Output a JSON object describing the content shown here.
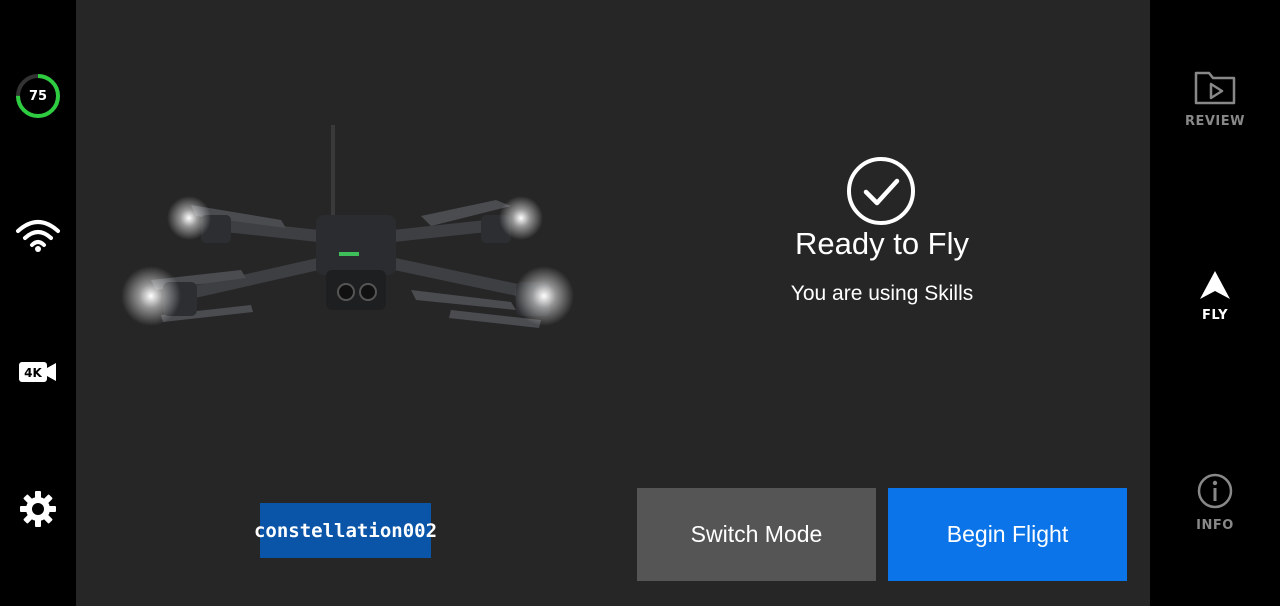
{
  "status": {
    "battery_percent": "75",
    "battery_level": 0.75,
    "icons": [
      "battery-ring",
      "wifi-icon",
      "4k-camera-icon",
      "gear-icon"
    ]
  },
  "main": {
    "ready_title": "Ready to Fly",
    "ready_subtitle": "You are using Skills",
    "drone_name": "constellation002",
    "switch_mode_label": "Switch Mode",
    "begin_flight_label": "Begin Flight"
  },
  "nav": {
    "review_label": "REVIEW",
    "fly_label": "FLY",
    "info_label": "INFO"
  },
  "colors": {
    "battery": "#2ecc40",
    "begin_flight": "#0a74e8",
    "switch_mode": "#555555",
    "badge": "#0a55a8",
    "main_bg": "#262626"
  }
}
